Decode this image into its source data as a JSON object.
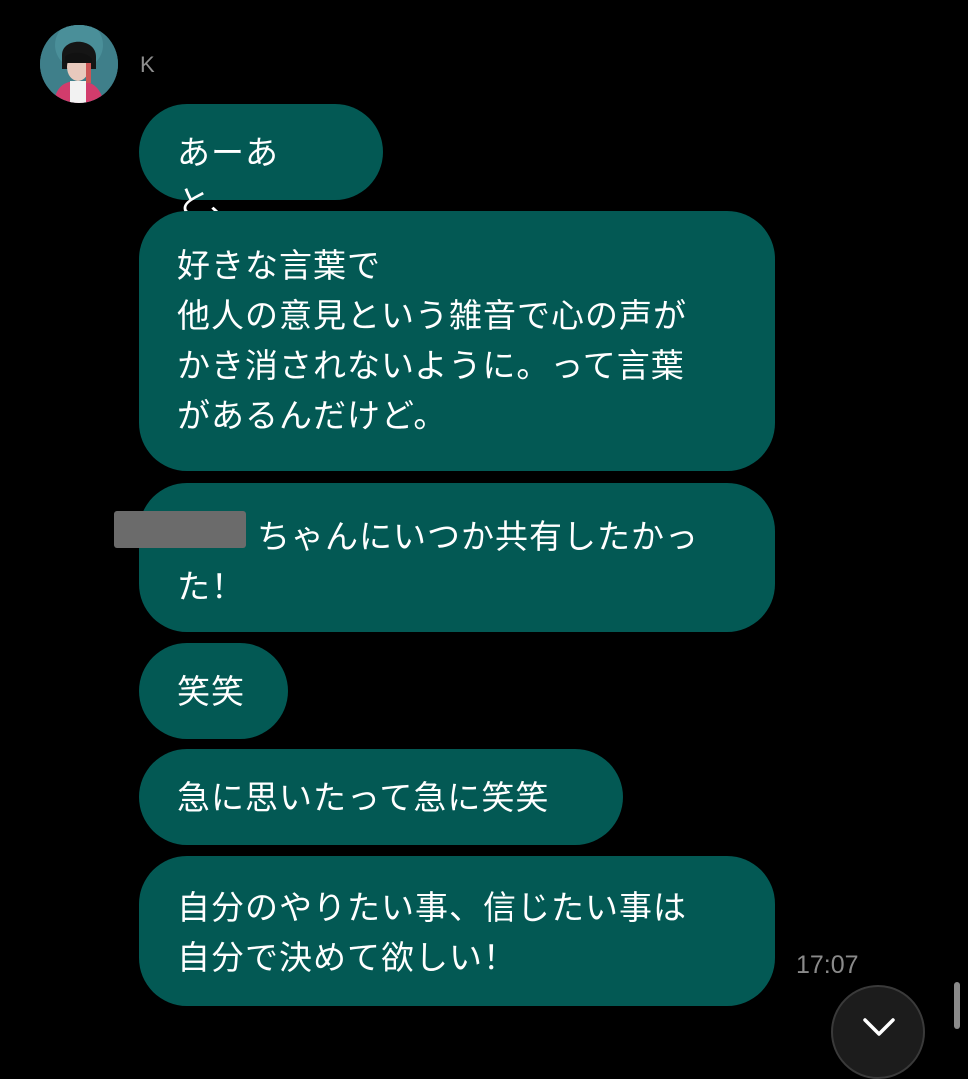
{
  "chat": {
    "sender_name": "K",
    "timestamp": "17:07",
    "messages": [
      {
        "text": "あーあと、"
      },
      {
        "text": "好きな言葉で\n他人の意見という雑音で心の声が\nかき消されないように。って言葉\nがあるんだけど。"
      },
      {
        "text": "ちゃんにいつか共有したかっ\nた！",
        "redacted_prefix": true
      },
      {
        "text": "笑笑"
      },
      {
        "text": "急に思いたって急に笑笑"
      },
      {
        "text": "自分のやりたい事、信じたい事は\n自分で決めて欲しい！"
      }
    ]
  },
  "colors": {
    "background": "#000000",
    "bubble": "#035954",
    "bubble_text": "#ffffff",
    "meta_text": "#8e8e8e",
    "redaction": "#6b6b6b"
  },
  "icons": {
    "scroll_down": "chevron-down-icon"
  }
}
